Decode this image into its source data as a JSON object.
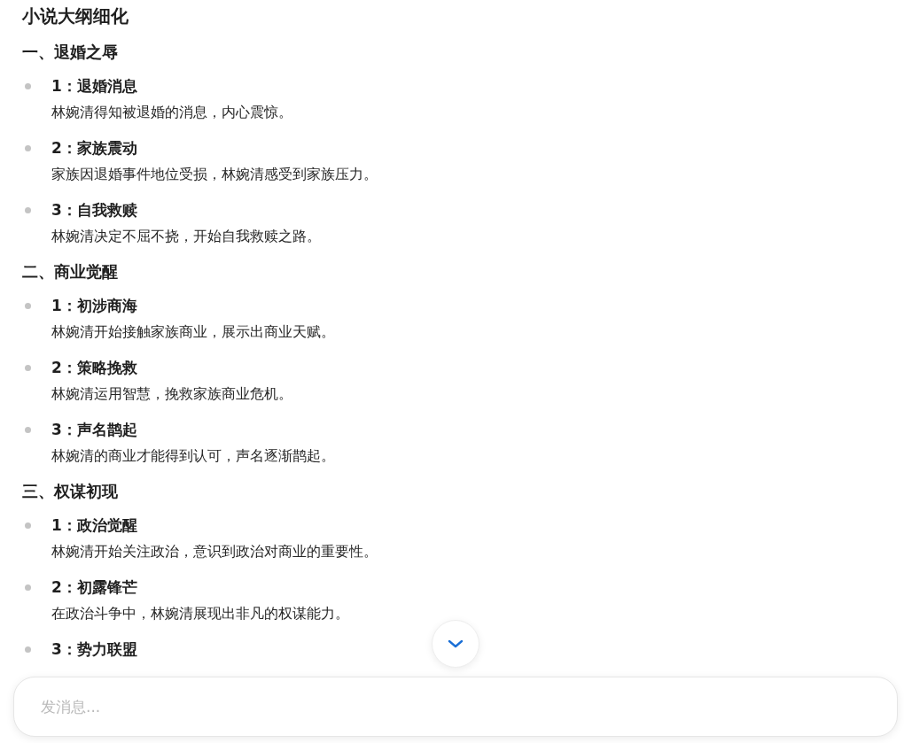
{
  "title": "小说大纲细化",
  "sections": [
    {
      "heading": "一、退婚之辱",
      "items": [
        {
          "label": "1：退婚消息",
          "description": "林婉清得知被退婚的消息，内心震惊。"
        },
        {
          "label": "2：家族震动",
          "description": "家族因退婚事件地位受损，林婉清感受到家族压力。"
        },
        {
          "label": "3：自我救赎",
          "description": "林婉清决定不屈不挠，开始自我救赎之路。"
        }
      ]
    },
    {
      "heading": "二、商业觉醒",
      "items": [
        {
          "label": "1：初涉商海",
          "description": "林婉清开始接触家族商业，展示出商业天赋。"
        },
        {
          "label": "2：策略挽救",
          "description": "林婉清运用智慧，挽救家族商业危机。"
        },
        {
          "label": "3：声名鹊起",
          "description": "林婉清的商业才能得到认可，声名逐渐鹊起。"
        }
      ]
    },
    {
      "heading": "三、权谋初现",
      "items": [
        {
          "label": "1：政治觉醒",
          "description": "林婉清开始关注政治，意识到政治对商业的重要性。"
        },
        {
          "label": "2：初露锋芒",
          "description": "在政治斗争中，林婉清展现出非凡的权谋能力。"
        },
        {
          "label": "3：势力联盟"
        }
      ]
    }
  ],
  "message_input": {
    "placeholder": "发消息..."
  }
}
